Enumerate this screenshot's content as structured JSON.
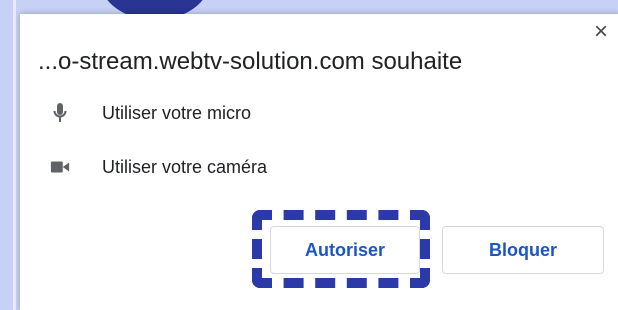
{
  "dialog": {
    "title": "...o-stream.webtv-solution.com souhaite",
    "close_label": "×",
    "permissions": [
      {
        "icon": "microphone-icon",
        "label": "Utiliser votre micro"
      },
      {
        "icon": "camera-icon",
        "label": "Utiliser votre caméra"
      }
    ],
    "buttons": {
      "allow_label": "Autoriser",
      "block_label": "Bloquer"
    }
  },
  "colors": {
    "backdrop": "#c7d1f5",
    "accent_circle": "#2a3593",
    "button_text": "#1a56c4",
    "highlight": "#2b3aa8"
  }
}
